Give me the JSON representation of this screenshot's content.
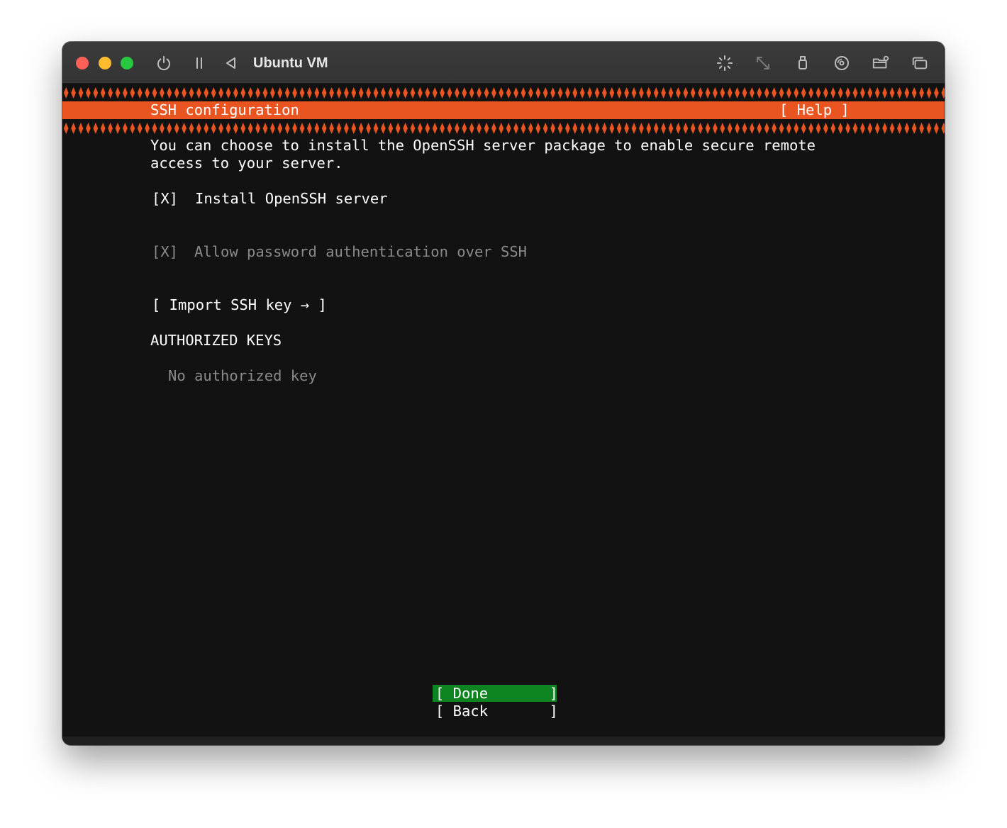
{
  "window": {
    "title": "Ubuntu VM"
  },
  "toolbar": {
    "icons": [
      "power-icon",
      "pause-icon",
      "back-icon",
      "brightness-icon",
      "resize-icon",
      "usb-icon",
      "disc-icon",
      "shared-folder-icon",
      "windows-icon"
    ]
  },
  "installer": {
    "header_title": "SSH configuration",
    "help_label": "[ Help ]",
    "intro_line1": "You can choose to install the OpenSSH server package to enable secure remote",
    "intro_line2": "access to your server.",
    "install_checkbox": "[X]",
    "install_label": "Install OpenSSH server",
    "password_checkbox": "[X]",
    "password_label": "Allow password authentication over SSH",
    "import_key_label": "[ Import SSH key → ]",
    "authorized_keys_heading": "AUTHORIZED KEYS",
    "no_keys_text": "No authorized key",
    "done_label": "[ Done       ]",
    "back_label": "[ Back       ]"
  },
  "colors": {
    "accent_orange": "#e95420",
    "selected_green": "#0e8420",
    "terminal_bg": "#121212"
  }
}
